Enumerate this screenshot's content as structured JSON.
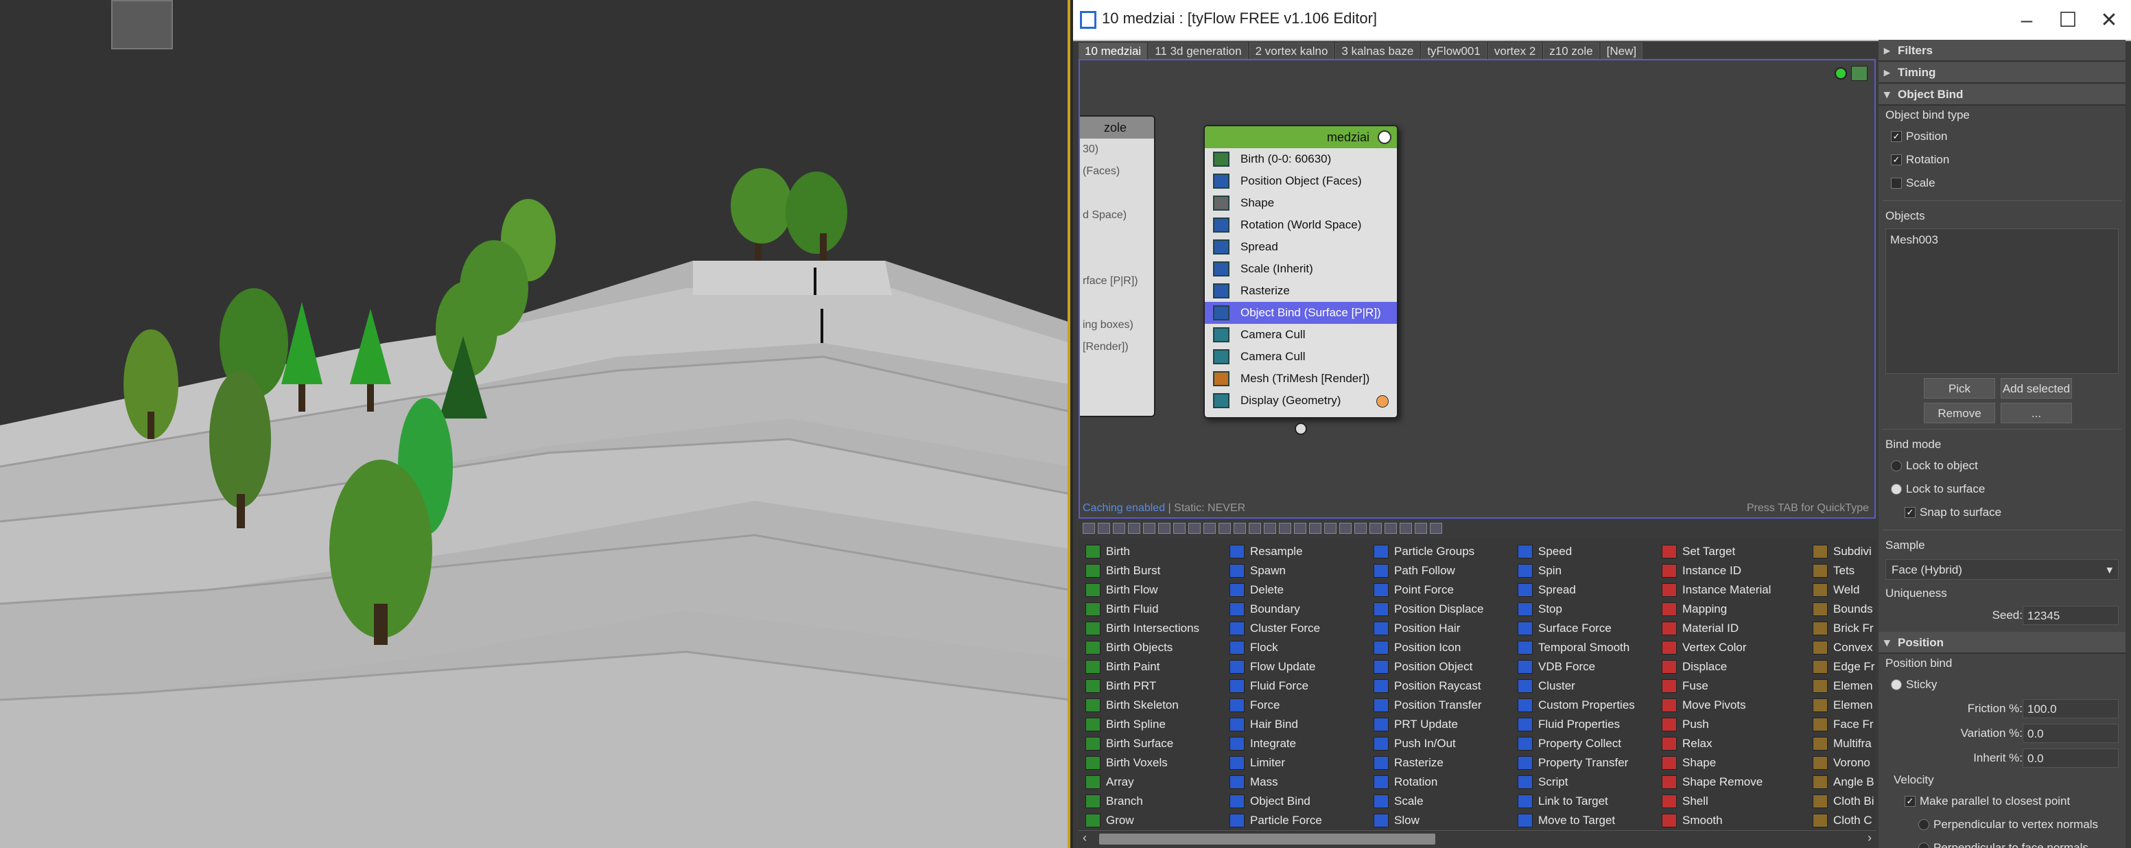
{
  "window": {
    "title": "10 medziai : [tyFlow FREE v1.106 Editor]"
  },
  "tabs": [
    "10 medziai",
    "11 3d generation",
    "2 vortex kalno",
    "3 kalnas baze",
    "tyFlow001",
    "vortex 2",
    "z10 zole",
    "[New]"
  ],
  "ghost_node": {
    "title": "zole",
    "lines": [
      "30)",
      "(Faces)",
      "",
      "d Space)",
      "",
      "",
      "rface [P|R])",
      "",
      "ing boxes)",
      "[Render])"
    ]
  },
  "node": {
    "title": "medziai",
    "operators": [
      {
        "label": "Birth (0-0: 60630)",
        "color": "#3a7a3a"
      },
      {
        "label": "Position Object (Faces)",
        "color": "#2a5aaa"
      },
      {
        "label": "Shape",
        "color": "#666"
      },
      {
        "label": "Rotation (World Space)",
        "color": "#2a5aaa"
      },
      {
        "label": "Spread",
        "color": "#2a5aaa"
      },
      {
        "label": "Scale (Inherit)",
        "color": "#2a5aaa"
      },
      {
        "label": "Rasterize",
        "color": "#2a5aaa"
      },
      {
        "label": "Object Bind (Surface [P|R])",
        "color": "#2a5aaa",
        "selected": true
      },
      {
        "label": "Camera Cull",
        "color": "#2a7a8a"
      },
      {
        "label": "Camera Cull",
        "color": "#2a7a8a"
      },
      {
        "label": "Mesh (TriMesh [Render])",
        "color": "#c07020"
      },
      {
        "label": "Display (Geometry)",
        "color": "#2a7a8a"
      }
    ]
  },
  "canvas_status": {
    "caching": "Caching enabled",
    "static": " | Static: NEVER",
    "hint": "Press TAB for QuickType"
  },
  "operator_columns": [
    [
      "Birth",
      "Birth Burst",
      "Birth Flow",
      "Birth Fluid",
      "Birth Intersections",
      "Birth Objects",
      "Birth Paint",
      "Birth PRT",
      "Birth Skeleton",
      "Birth Spline",
      "Birth Surface",
      "Birth Voxels",
      "Array",
      "Branch",
      "Grow"
    ],
    [
      "Resample",
      "Spawn",
      "Delete",
      "Boundary",
      "Cluster Force",
      "Flock",
      "Flow Update",
      "Fluid Force",
      "Force",
      "Hair Bind",
      "Integrate",
      "Limiter",
      "Mass",
      "Object Bind",
      "Particle Force"
    ],
    [
      "Particle Groups",
      "Path Follow",
      "Point Force",
      "Position Displace",
      "Position Hair",
      "Position Icon",
      "Position Object",
      "Position Raycast",
      "Position Transfer",
      "PRT Update",
      "Push In/Out",
      "Rasterize",
      "Rotation",
      "Scale",
      "Slow"
    ],
    [
      "Speed",
      "Spin",
      "Spread",
      "Stop",
      "Surface Force",
      "Temporal Smooth",
      "VDB Force",
      "Cluster",
      "Custom Properties",
      "Fluid Properties",
      "Property Collect",
      "Property Transfer",
      "Script",
      "Link to Target",
      "Move to Target"
    ],
    [
      "Set Target",
      "Instance ID",
      "Instance Material",
      "Mapping",
      "Material ID",
      "Vertex Color",
      "Displace",
      "Fuse",
      "Move Pivots",
      "Push",
      "Relax",
      "Shape",
      "Shape Remove",
      "Shell",
      "Smooth"
    ],
    [
      "Subdivi",
      "Tets",
      "Weld",
      "Bounds",
      "Brick Fr",
      "Convex",
      "Edge Fr",
      "Elemen",
      "Elemen",
      "Face Fr",
      "Multifra",
      "Vorono",
      "Angle B",
      "Cloth Bi",
      "Cloth C"
    ]
  ],
  "column_colors": [
    "#2e8a2e",
    "#2a5ad0",
    "#2a5ad0",
    "#2a5ad0",
    "#c03030",
    "#8a6a2a"
  ],
  "panel": {
    "rollouts": {
      "filters": "Filters",
      "timing": "Timing",
      "object_bind": "Object Bind",
      "position": "Position"
    },
    "object_bind_type": "Object bind type",
    "position": "Position",
    "rotation": "Rotation",
    "scale": "Scale",
    "objects_label": "Objects",
    "objects": [
      "Mesh003"
    ],
    "pick": "Pick",
    "add_selected": "Add selected",
    "remove": "Remove",
    "more": "...",
    "bind_mode": "Bind mode",
    "lock_object": "Lock to object",
    "lock_surface": "Lock to surface",
    "snap_surface": "Snap to surface",
    "sample_label": "Sample",
    "sample_value": "Face (Hybrid)",
    "uniqueness": "Uniqueness",
    "seed_label": "Seed:",
    "seed_value": "12345",
    "position_bind": "Position bind",
    "sticky": "Sticky",
    "friction_label": "Friction %:",
    "friction_value": "100.0",
    "variation_label": "Variation %:",
    "variation_value": "0.0",
    "inherit_label": "Inherit %:",
    "inherit_value": "0.0",
    "velocity": "Velocity",
    "make_parallel": "Make parallel to closest point",
    "perp_vertex": "Perpendicular to vertex normals",
    "perp_face": "Perpendicular to face normals"
  }
}
